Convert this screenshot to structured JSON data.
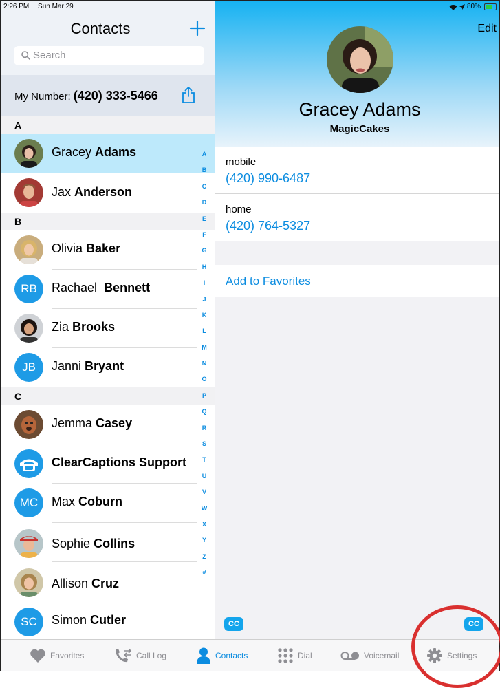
{
  "status_bar": {
    "time": "2:26 PM",
    "date": "Sun Mar 29",
    "battery": "80%",
    "battery_level": 0.8
  },
  "contacts_pane": {
    "title": "Contacts",
    "search_placeholder": "Search",
    "my_number_label": "My Number:",
    "my_number": "(420) 333-5466",
    "sections": [
      "A",
      "B",
      "C"
    ],
    "contacts": [
      {
        "first": "Gracey",
        "last": "Adams",
        "avatar": "photo",
        "selected": true
      },
      {
        "first": "Jax",
        "last": "Anderson",
        "avatar": "photo"
      },
      {
        "first": "Olivia",
        "last": "Baker",
        "avatar": "photo"
      },
      {
        "first": "Rachael",
        "last": "Bennett",
        "avatar": "initials",
        "initials": "RB"
      },
      {
        "first": "Zia",
        "last": "Brooks",
        "avatar": "photo"
      },
      {
        "first": "Janni",
        "last": "Bryant",
        "avatar": "initials",
        "initials": "JB"
      },
      {
        "first": "Jemma",
        "last": "Casey",
        "avatar": "photo"
      },
      {
        "full": "ClearCaptions Support",
        "avatar": "clearcaptions-logo"
      },
      {
        "first": "Max",
        "last": "Coburn",
        "avatar": "initials",
        "initials": "MC"
      },
      {
        "first": "Sophie",
        "last": "Collins",
        "avatar": "photo"
      },
      {
        "first": "Allison",
        "last": "Cruz",
        "avatar": "photo"
      },
      {
        "first": "Simon",
        "last": "Cutler",
        "avatar": "initials",
        "initials": "SC"
      }
    ],
    "alphabet_index": [
      "A",
      "B",
      "C",
      "D",
      "E",
      "F",
      "G",
      "H",
      "I",
      "J",
      "K",
      "L",
      "M",
      "N",
      "O",
      "P",
      "Q",
      "R",
      "S",
      "T",
      "U",
      "V",
      "W",
      "X",
      "Y",
      "Z",
      "#"
    ]
  },
  "detail_pane": {
    "edit_label": "Edit",
    "name": "Gracey Adams",
    "company": "MagicCakes",
    "phones": [
      {
        "label": "mobile",
        "number": "(420) 990-6487"
      },
      {
        "label": "home",
        "number": "(420) 764-5327"
      }
    ],
    "add_to_favorites": "Add to Favorites",
    "cc_badge": "CC"
  },
  "tab_bar": {
    "tabs": [
      {
        "label": "Favorites",
        "icon": "heart-icon"
      },
      {
        "label": "Call Log",
        "icon": "call-log-icon"
      },
      {
        "label": "Contacts",
        "icon": "person-icon",
        "active": true
      },
      {
        "label": "Dial",
        "icon": "dialpad-icon"
      },
      {
        "label": "Voicemail",
        "icon": "voicemail-icon"
      },
      {
        "label": "Settings",
        "icon": "gear-icon"
      }
    ]
  },
  "colors": {
    "accent": "#0b8ce0",
    "selected_row": "#bde9fb",
    "annotation_ring": "#d9302f"
  }
}
